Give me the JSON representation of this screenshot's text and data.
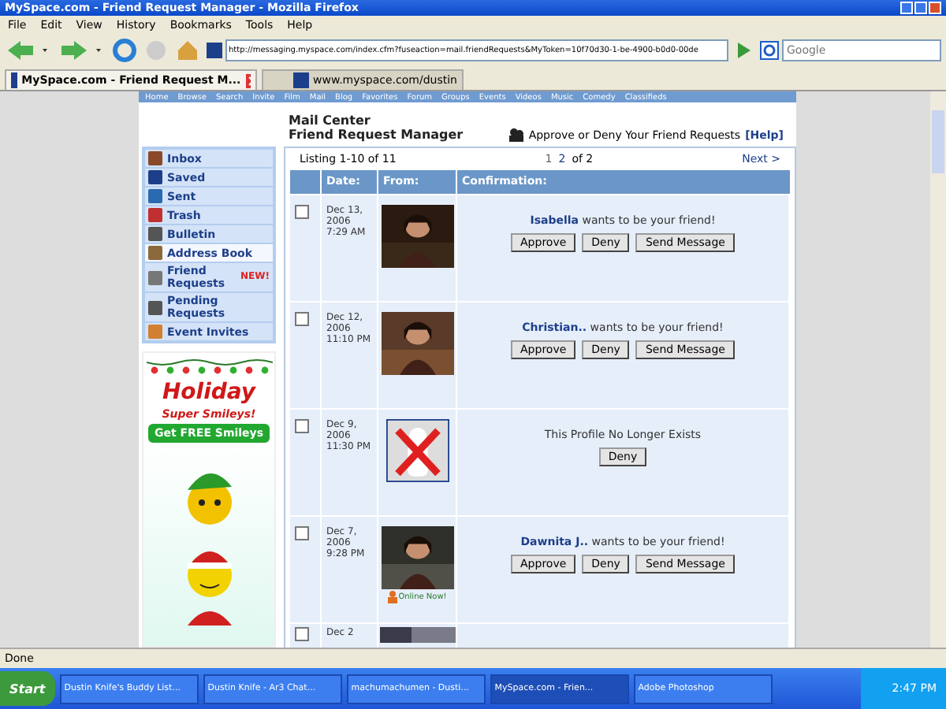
{
  "window": {
    "title": "MySpace.com - Friend Request Manager - Mozilla Firefox"
  },
  "menu": [
    "File",
    "Edit",
    "View",
    "History",
    "Bookmarks",
    "Tools",
    "Help"
  ],
  "address": {
    "value": "http://messaging.myspace.com/index.cfm?fuseaction=mail.friendRequests&MyToken=10f70d30-1-be-4900-b0d0-00de"
  },
  "search": {
    "placeholder": "Google"
  },
  "tabs": [
    {
      "label": "MySpace.com - Friend Request M...",
      "selected": true
    },
    {
      "label": "www.myspace.com/dustin",
      "selected": false
    }
  ],
  "site_nav": [
    "Home",
    "Browse",
    "Search",
    "Invite",
    "Film",
    "Mail",
    "Blog",
    "Favorites",
    "Forum",
    "Groups",
    "Events",
    "Videos",
    "Music",
    "Comedy",
    "Classifieds"
  ],
  "header": {
    "section": "Mail Center",
    "title": "Friend Request Manager",
    "hint": "Approve or Deny Your Friend Requests",
    "help": "[Help]"
  },
  "sidebar": {
    "items": [
      {
        "label": "Inbox",
        "selected": false
      },
      {
        "label": "Saved",
        "selected": false
      },
      {
        "label": "Sent",
        "selected": false
      },
      {
        "label": "Trash",
        "selected": false
      },
      {
        "label": "Bulletin",
        "selected": false
      },
      {
        "label": "Address Book",
        "selected": true
      },
      {
        "label": "Friend Requests",
        "selected": false,
        "badge": "NEW!"
      },
      {
        "label": "Pending Requests",
        "selected": false
      },
      {
        "label": "Event Invites",
        "selected": false
      }
    ]
  },
  "ad": {
    "title": "Holiday",
    "subtitle": "Super Smileys!",
    "button": "Get FREE Smileys"
  },
  "listing": {
    "summary": "Listing 1-10 of 11",
    "pages": [
      {
        "label": "1",
        "selected": true
      },
      {
        "label": "2",
        "selected": false
      }
    ],
    "of": "of 2",
    "next": "Next >"
  },
  "table": {
    "columns": [
      "Date:",
      "From:",
      "Confirmation:"
    ],
    "rows": [
      {
        "kind": "request",
        "checked": false,
        "date": "Dec 13, 2006 7:29 AM",
        "name": "Isabella",
        "message": "wants to be your friend!",
        "buttons": [
          "Approve",
          "Deny",
          "Send Message"
        ]
      },
      {
        "kind": "request",
        "checked": false,
        "date": "Dec 12, 2006 11:10 PM",
        "name": "Christian..",
        "message": "wants to be your friend!",
        "buttons": [
          "Approve",
          "Deny",
          "Send Message"
        ]
      },
      {
        "kind": "deleted",
        "checked": false,
        "date": "Dec 9, 2006 11:30 PM",
        "message": "This Profile No Longer Exists",
        "buttons": [
          "Deny"
        ]
      },
      {
        "kind": "request",
        "checked": false,
        "date": "Dec 7, 2006 9:28 PM",
        "name": "Dawnita J..",
        "message": "wants to be your friend!",
        "online": "Online Now!",
        "buttons": [
          "Approve",
          "Deny",
          "Send Message"
        ]
      },
      {
        "kind": "partial",
        "checked": false,
        "date": "Dec 2"
      }
    ]
  },
  "status_bar": "Done",
  "taskbar": {
    "start": "Start",
    "items": [
      {
        "label": "Dustin Knife's Buddy List...",
        "selected": false
      },
      {
        "label": "Dustin Knife - Ar3 Chat...",
        "selected": false
      },
      {
        "label": "machumachumen - Dusti...",
        "selected": false
      },
      {
        "label": "MySpace.com - Frien...",
        "selected": true
      },
      {
        "label": "Adobe Photoshop",
        "selected": false
      }
    ],
    "time": "2:47 PM"
  }
}
